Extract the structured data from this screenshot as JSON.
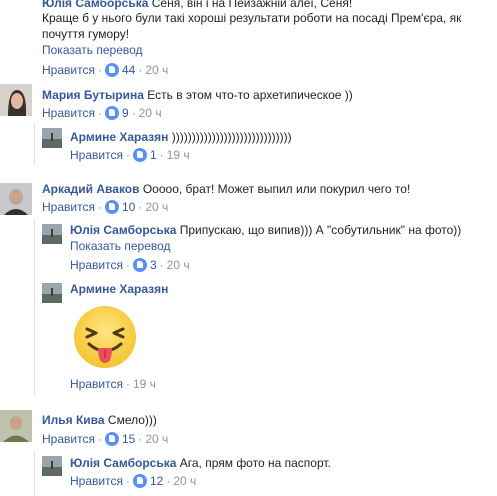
{
  "comments": [
    {
      "author": "Юлія Самборська",
      "lines": [
        "Сеня, він і на Пейзажній алеї, Сеня!",
        "Краще б у нього були такі хороші результати роботи на посаді Прем'єра, як",
        "почуття гумору!"
      ],
      "translate": "Показать перевод",
      "like_label": "Нравится",
      "likes": "44",
      "time": "20 ч"
    },
    {
      "author": "Мария Бутырина",
      "text": "Есть в этом что-то архетипическое ))",
      "like_label": "Нравится",
      "likes": "9",
      "time": "20 ч"
    },
    {
      "author": "Армине Харазян",
      "text": "))))))))))))))))))))))))))))))",
      "like_label": "Нравится",
      "likes": "1",
      "time": "19 ч"
    },
    {
      "author": "Аркадий Аваков",
      "text": "Ооооо, брат! Может выпил или покурил чего то!",
      "like_label": "Нравится",
      "likes": "10",
      "time": "20 ч"
    },
    {
      "author": "Юлія Самборська",
      "text": "Припускаю, що випив))) А \"собутильник\" на фото))",
      "translate": "Показать перевод",
      "like_label": "Нравится",
      "likes": "3",
      "time": "20 ч"
    },
    {
      "author": "Армине Харазян",
      "sticker": "tongue-out-emoji",
      "like_label": "Нравится",
      "time": "19 ч"
    },
    {
      "author": "Илья Кива",
      "text": "Смело)))",
      "like_label": "Нравится",
      "likes": "15",
      "time": "20 ч"
    },
    {
      "author": "Юлія Самборська",
      "text": "Ага, прям фото на паспорт.",
      "like_label": "Нравится",
      "likes": "12",
      "time": "20 ч"
    }
  ],
  "colors": {
    "link": "#365899",
    "meta": "#90949c",
    "like": "#5890ff"
  }
}
